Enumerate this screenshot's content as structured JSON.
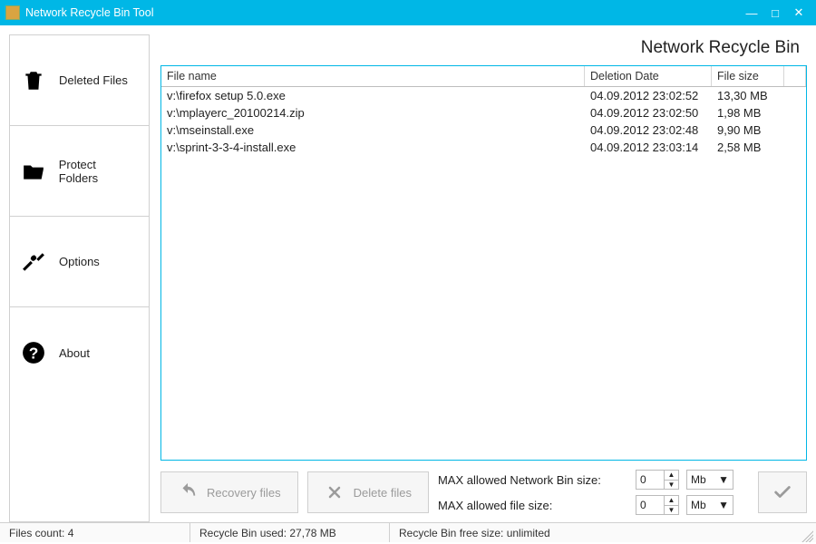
{
  "window": {
    "title": "Network Recycle Bin Tool"
  },
  "sidebar": {
    "items": [
      {
        "label": "Deleted Files"
      },
      {
        "label": "Protect Folders"
      },
      {
        "label": "Options"
      },
      {
        "label": "About"
      }
    ]
  },
  "page": {
    "title": "Network Recycle Bin"
  },
  "table": {
    "headers": {
      "name": "File name",
      "date": "Deletion Date",
      "size": "File size"
    },
    "rows": [
      {
        "name": "v:\\firefox setup 5.0.exe",
        "date": "04.09.2012 23:02:52",
        "size": "13,30 MB"
      },
      {
        "name": "v:\\mplayerc_20100214.zip",
        "date": "04.09.2012 23:02:50",
        "size": "1,98 MB"
      },
      {
        "name": "v:\\mseinstall.exe",
        "date": "04.09.2012 23:02:48",
        "size": "9,90 MB"
      },
      {
        "name": "v:\\sprint-3-3-4-install.exe",
        "date": "04.09.2012 23:03:14",
        "size": "2,58 MB"
      }
    ]
  },
  "actions": {
    "recovery": "Recovery files",
    "delete": "Delete files"
  },
  "limits": {
    "bin_label": "MAX allowed Network Bin size:",
    "file_label": "MAX allowed file size:",
    "bin_value": "0",
    "file_value": "0",
    "unit": "Mb"
  },
  "status": {
    "count": "Files count: 4",
    "used": "Recycle Bin used: 27,78 MB",
    "free": "Recycle Bin free size: unlimited"
  }
}
